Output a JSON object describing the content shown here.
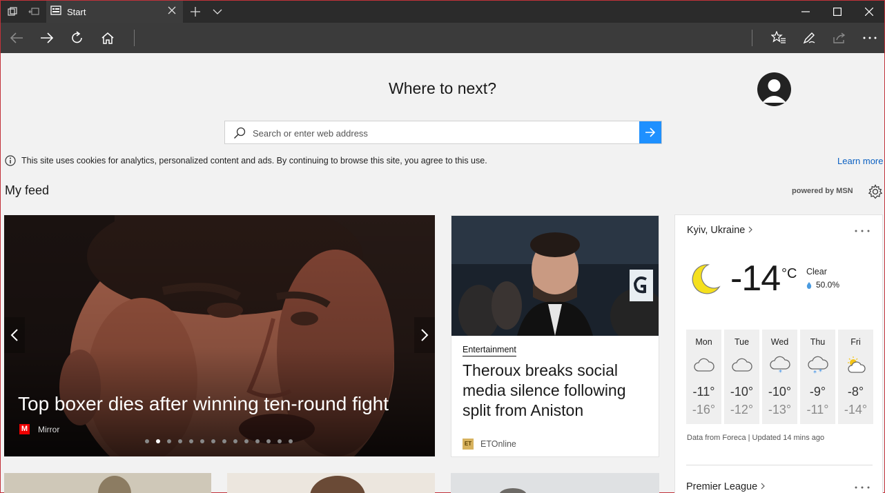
{
  "browser": {
    "tab_title": "Start",
    "new_tab_symbol": "+"
  },
  "start_page": {
    "heading": "Where to next?",
    "search_placeholder": "Search or enter web address"
  },
  "cookie_notice": {
    "text": "This site uses cookies for analytics, personalized content and ads. By continuing to browse this site, you agree to this use.",
    "learn_more": "Learn more"
  },
  "feed": {
    "title": "My feed",
    "powered_by": "powered by MSN"
  },
  "hero_story": {
    "headline": "Top boxer dies after winning ten-round fight",
    "source": "Mirror",
    "source_logo": "M",
    "slide_count": 14,
    "active_slide": 2
  },
  "story2": {
    "category": "Entertainment",
    "headline": "Theroux breaks social media silence following split from Aniston",
    "source": "ETOnline",
    "source_logo": "ET"
  },
  "weather": {
    "location": "Kyiv, Ukraine",
    "temp": "-14",
    "unit": "°C",
    "condition": "Clear",
    "humidity": "50.0%",
    "forecast": [
      {
        "day": "Mon",
        "hi": "-11°",
        "lo": "-16°",
        "icon": "cloudy-icon"
      },
      {
        "day": "Tue",
        "hi": "-10°",
        "lo": "-12°",
        "icon": "cloudy-icon"
      },
      {
        "day": "Wed",
        "hi": "-10°",
        "lo": "-13°",
        "icon": "light-snow-icon"
      },
      {
        "day": "Thu",
        "hi": "-9°",
        "lo": "-11°",
        "icon": "snow-icon"
      },
      {
        "day": "Fri",
        "hi": "-8°",
        "lo": "-14°",
        "icon": "partly-sunny-icon"
      }
    ],
    "data_source": "Data from Foreca | Updated 14 mins ago"
  },
  "premier_league": {
    "title": "Premier League"
  },
  "colors": {
    "accent": "#1e90ff",
    "link": "#0a60c2",
    "titlebar": "#2b2b2b",
    "toolbar": "#3b3b3b"
  }
}
